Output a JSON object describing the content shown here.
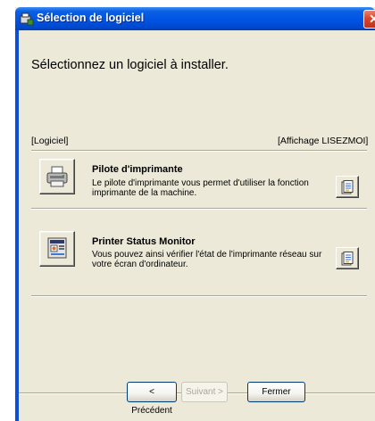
{
  "window": {
    "title": "Sélection de logiciel"
  },
  "main": {
    "heading": "Sélectionnez un logiciel à installer.",
    "software_label": "[Logiciel]",
    "readme_label": "[Affichage LISEZMOI]"
  },
  "items": [
    {
      "title": "Pilote d'imprimante",
      "description": "Le pilote d'imprimante vous permet d'utiliser la fonction imprimante de la machine.",
      "icon": "printer-icon"
    },
    {
      "title": "Printer Status Monitor",
      "description": "Vous pouvez ainsi vérifier l'état de l'imprimante réseau sur votre écran d'ordinateur.",
      "icon": "status-monitor-icon"
    }
  ],
  "buttons": {
    "back": "< Précédent",
    "next": "Suivant >",
    "close": "Fermer"
  },
  "colors": {
    "title_bar": "#0054e3",
    "window_bg": "#ece9d8",
    "close_red": "#d9442b"
  }
}
